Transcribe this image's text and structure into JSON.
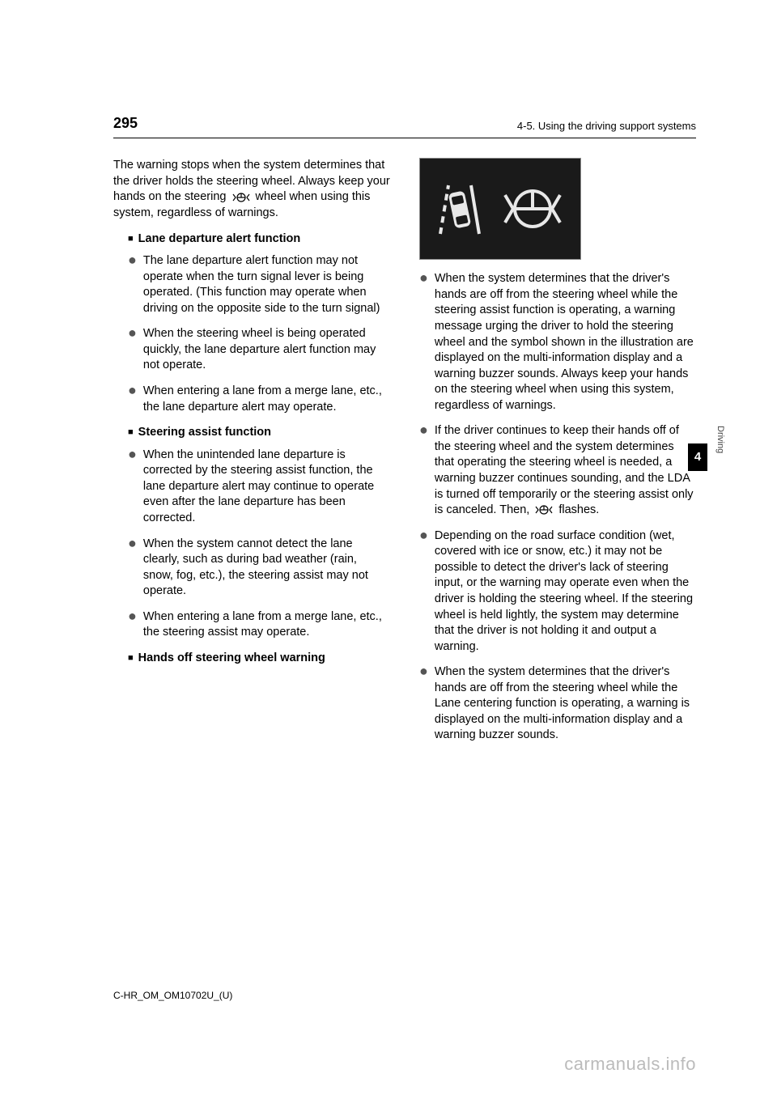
{
  "header": {
    "page_number": "295",
    "section": "4-5. Using the driving support systems"
  },
  "sidetab": {
    "number": "4",
    "label": "Driving"
  },
  "col1": {
    "intro": "The warning stops when the system determines that the driver holds the steering wheel. Always keep your hands on the steering wheel when using this system, regardless of warnings.",
    "sec1": {
      "title": "Lane departure alert function",
      "b1": "The lane departure alert function may not operate when the turn signal lever is being operated. (This function may operate when driving on the opposite side to the turn signal)",
      "b2": "When the steering wheel is being operated quickly, the lane departure alert function may not operate.",
      "b3": "When entering a lane from a merge lane, etc., the lane departure alert may operate."
    },
    "sec2": {
      "title": "Steering assist function",
      "b1": "When the unintended lane departure is corrected by the steering assist function, the lane departure alert may continue to operate even after the lane departure has been corrected.",
      "b2": "When the system cannot detect the lane clearly, such as during bad weather (rain, snow, fog, etc.), the steering assist may not operate.",
      "b3": "When entering a lane from a merge lane, etc., the steering assist may operate."
    },
    "sec3": {
      "title": "Hands off steering wheel warning"
    }
  },
  "col2": {
    "b1": "When the system determines that the driver's hands are off from the steering wheel while the steering assist function is operating, a warning message urging the driver to hold the steering wheel and the symbol shown in the illustration are displayed on the multi-information display and a warning buzzer sounds. Always keep your hands on the steering wheel when using this system, regardless of warnings.",
    "b2_before": "If the driver continues to keep their hands off of the steering wheel and the system determines that operating the steering wheel is needed, a warning buzzer continues sounding, and the LDA is turned off temporarily or the steering assist only is canceled. Then, ",
    "b2_after": " flashes.",
    "b3": "Depending on the road surface condition (wet, covered with ice or snow, etc.) it may not be possible to detect the driver's lack of steering input, or the warning may operate even when the driver is holding the steering wheel. If the steering wheel is held lightly, the system may determine that the driver is not holding it and output a warning.",
    "b4": "When the system determines that the driver's hands are off from the steering wheel while the Lane centering function is operating, a warning is displayed on the multi-information display and a warning buzzer sounds."
  },
  "footer": {
    "doc_ref": "C-HR_OM_OM10702U_(U)",
    "watermark": "carmanuals.info"
  }
}
